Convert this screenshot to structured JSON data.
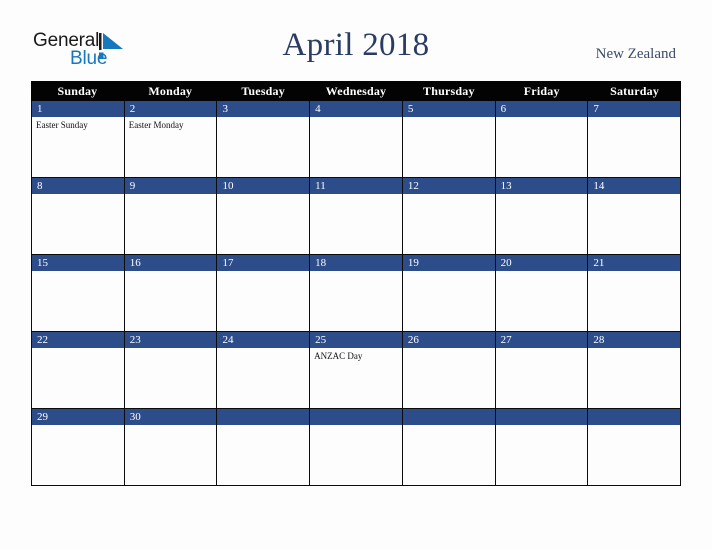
{
  "logo": {
    "word_one": "General",
    "word_two": "Blue",
    "mark_name": "blue-triangle-logo-mark",
    "black_hex": "#1a1a1a",
    "blue_hex": "#1878be"
  },
  "header": {
    "title": "April 2018",
    "locale": "New Zealand",
    "title_color": "#2b3c63"
  },
  "calendar": {
    "weekdays": [
      "Sunday",
      "Monday",
      "Tuesday",
      "Wednesday",
      "Thursday",
      "Friday",
      "Saturday"
    ],
    "header_bg": "#030303",
    "day_band_bg": "#2d4d8a",
    "cell_bg": "#fdfdfd",
    "grid_line": "#0c0c0c",
    "weeks": [
      {
        "days": [
          {
            "number": "1",
            "events": [
              "Easter Sunday"
            ]
          },
          {
            "number": "2",
            "events": [
              "Easter Monday"
            ]
          },
          {
            "number": "3",
            "events": []
          },
          {
            "number": "4",
            "events": []
          },
          {
            "number": "5",
            "events": []
          },
          {
            "number": "6",
            "events": []
          },
          {
            "number": "7",
            "events": []
          }
        ]
      },
      {
        "days": [
          {
            "number": "8",
            "events": []
          },
          {
            "number": "9",
            "events": []
          },
          {
            "number": "10",
            "events": []
          },
          {
            "number": "11",
            "events": []
          },
          {
            "number": "12",
            "events": []
          },
          {
            "number": "13",
            "events": []
          },
          {
            "number": "14",
            "events": []
          }
        ]
      },
      {
        "days": [
          {
            "number": "15",
            "events": []
          },
          {
            "number": "16",
            "events": []
          },
          {
            "number": "17",
            "events": []
          },
          {
            "number": "18",
            "events": []
          },
          {
            "number": "19",
            "events": []
          },
          {
            "number": "20",
            "events": []
          },
          {
            "number": "21",
            "events": []
          }
        ]
      },
      {
        "days": [
          {
            "number": "22",
            "events": []
          },
          {
            "number": "23",
            "events": []
          },
          {
            "number": "24",
            "events": []
          },
          {
            "number": "25",
            "events": [
              "ANZAC Day"
            ]
          },
          {
            "number": "26",
            "events": []
          },
          {
            "number": "27",
            "events": []
          },
          {
            "number": "28",
            "events": []
          }
        ]
      },
      {
        "days": [
          {
            "number": "29",
            "events": []
          },
          {
            "number": "30",
            "events": []
          },
          {
            "number": "",
            "events": []
          },
          {
            "number": "",
            "events": []
          },
          {
            "number": "",
            "events": []
          },
          {
            "number": "",
            "events": []
          },
          {
            "number": "",
            "events": []
          }
        ]
      }
    ]
  }
}
